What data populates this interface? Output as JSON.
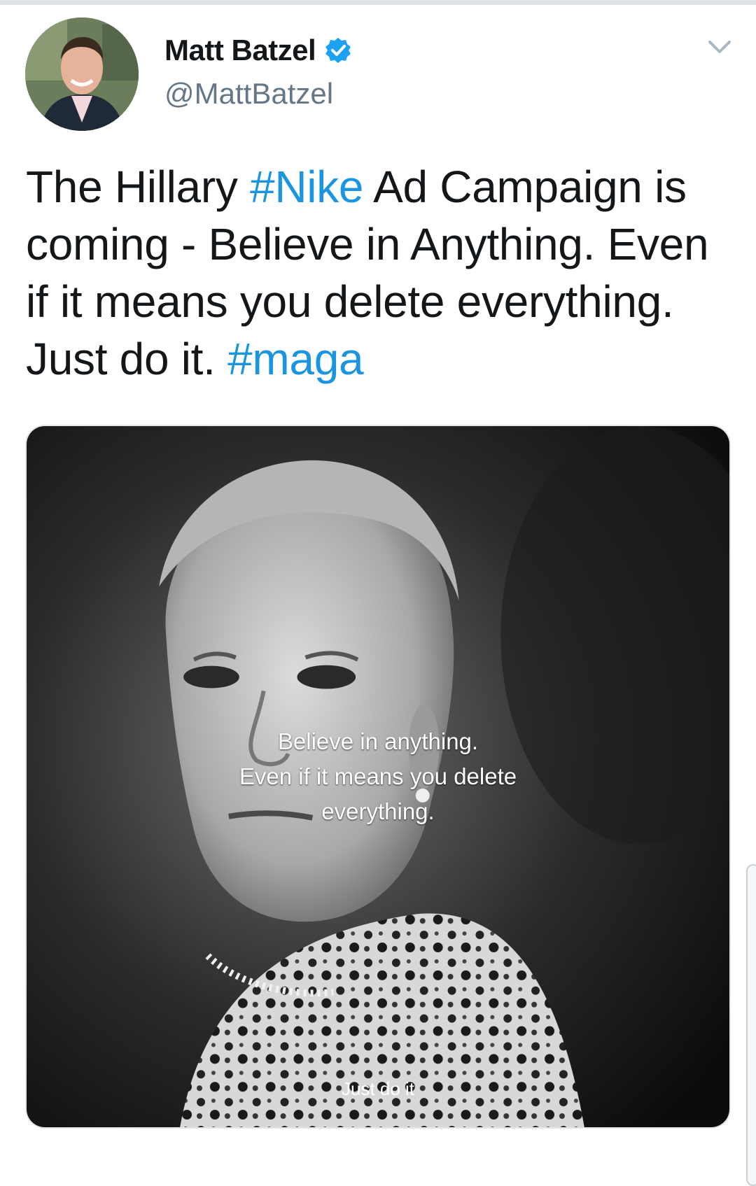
{
  "tweet": {
    "author_name": "Matt Batzel",
    "author_handle": "@MattBatzel",
    "text_parts": [
      {
        "text": "The Hillary ",
        "type": "text"
      },
      {
        "text": "#Nike",
        "type": "hashtag"
      },
      {
        "text": " Ad Campaign is coming - Believe in Anything. Even if it means you delete everything. Just do it. ",
        "type": "text"
      },
      {
        "text": "#maga",
        "type": "hashtag"
      }
    ]
  },
  "media": {
    "overlay_lines": [
      "Believe in anything.",
      "Even if it means you delete",
      "everything."
    ],
    "tagline": "Just do it"
  },
  "icons": {
    "verified": "verified-badge-icon",
    "menu": "chevron-down-icon"
  },
  "colors": {
    "hashtag": "#1b95e0",
    "name": "#14171a",
    "handle": "#657786",
    "verified": "#1da1f2"
  }
}
